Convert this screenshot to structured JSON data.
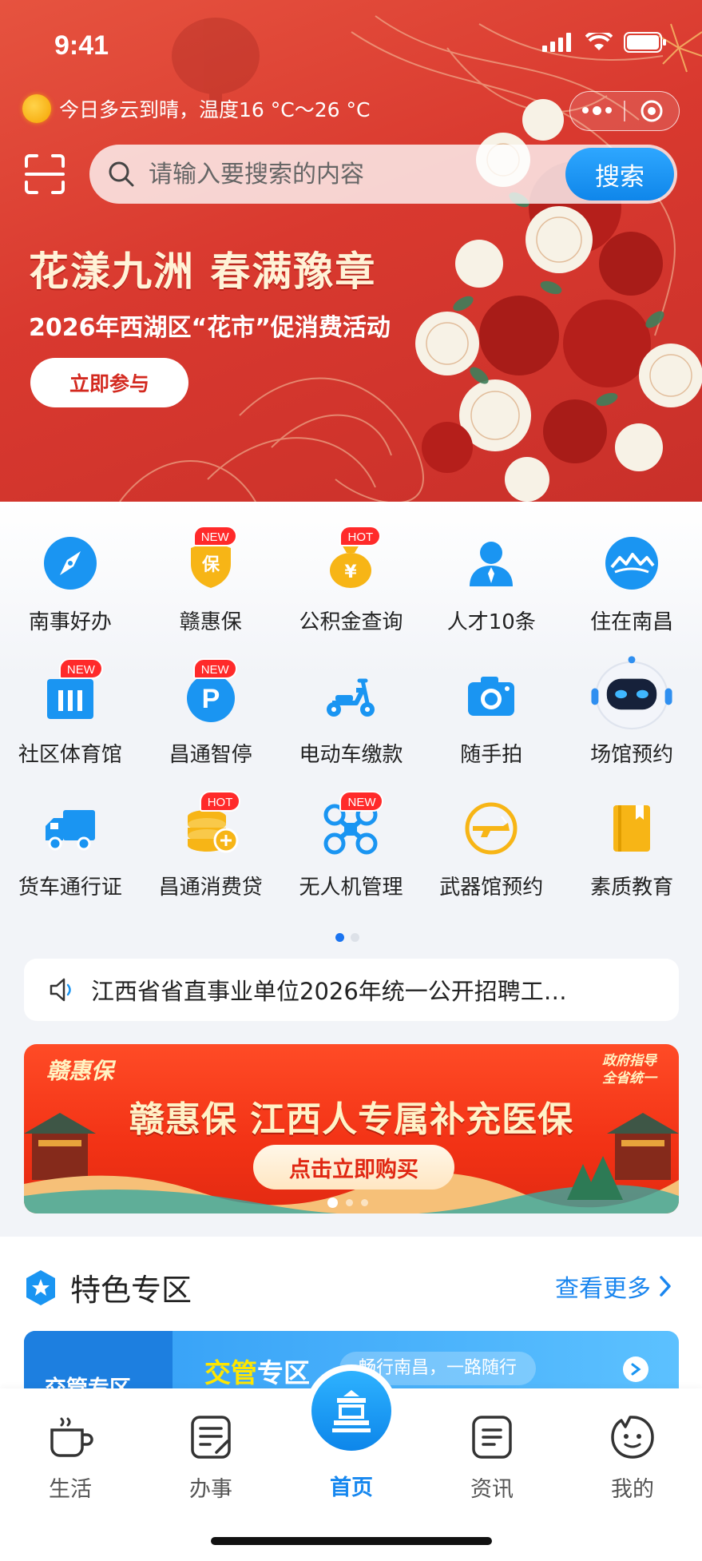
{
  "status_bar": {
    "time": "9:41"
  },
  "weather": {
    "text": "今日多云到晴，温度16 °C～26 °C"
  },
  "search": {
    "placeholder": "请输入要搜索的内容",
    "button": "搜索"
  },
  "hero": {
    "title": "花漾九洲 春满豫章",
    "subtitle": "2026年西湖区“花市”促消费活动",
    "cta": "立即参与"
  },
  "services": [
    [
      {
        "label": "南事好办",
        "icon": "compass-icon",
        "badge": ""
      },
      {
        "label": "赣惠保",
        "icon": "shield-icon",
        "badge": "NEW"
      },
      {
        "label": "公积金查询",
        "icon": "money-bag-icon",
        "badge": "HOT"
      },
      {
        "label": "人才10条",
        "icon": "person-icon",
        "badge": ""
      },
      {
        "label": "住在南昌",
        "icon": "city-icon",
        "badge": ""
      }
    ],
    [
      {
        "label": "社区体育馆",
        "icon": "gym-icon",
        "badge": "NEW"
      },
      {
        "label": "昌通智停",
        "icon": "parking-icon",
        "badge": "NEW"
      },
      {
        "label": "电动车缴款",
        "icon": "scooter-icon",
        "badge": ""
      },
      {
        "label": "随手拍",
        "icon": "camera-icon",
        "badge": ""
      },
      {
        "label": "场馆预约",
        "icon": "robot-icon",
        "badge": ""
      }
    ],
    [
      {
        "label": "货车通行证",
        "icon": "truck-icon",
        "badge": ""
      },
      {
        "label": "昌通消费贷",
        "icon": "coins-icon",
        "badge": "HOT"
      },
      {
        "label": "无人机管理",
        "icon": "drone-icon",
        "badge": "NEW"
      },
      {
        "label": "武器馆预约",
        "icon": "weapon-icon",
        "badge": ""
      },
      {
        "label": "素质教育",
        "icon": "book-icon",
        "badge": ""
      }
    ]
  ],
  "notice": {
    "text": "江西省省直事业单位2026年统一公开招聘工…"
  },
  "promo": {
    "logo": "赣惠保",
    "tag_line1": "政府指导",
    "tag_line2": "全省统一",
    "title": "赣惠保 江西人专属补充医保",
    "button": "点击立即购买"
  },
  "feature": {
    "title": "特色专区",
    "more": "查看更多",
    "card": {
      "left_label": "交管专区",
      "title_highlight": "交管",
      "title_rest": "专区",
      "slogan": "畅行南昌，一路随行"
    }
  },
  "tabbar": [
    {
      "label": "生活",
      "icon": "coffee-cup-icon"
    },
    {
      "label": "办事",
      "icon": "document-edit-icon"
    },
    {
      "label": "首页",
      "icon": "home-logo-icon"
    },
    {
      "label": "资讯",
      "icon": "news-icon"
    },
    {
      "label": "我的",
      "icon": "profile-face-icon"
    }
  ],
  "colors": {
    "hero_red": "#d9392f",
    "accent_blue": "#1687ef",
    "badge_red": "#ff2a2a"
  }
}
